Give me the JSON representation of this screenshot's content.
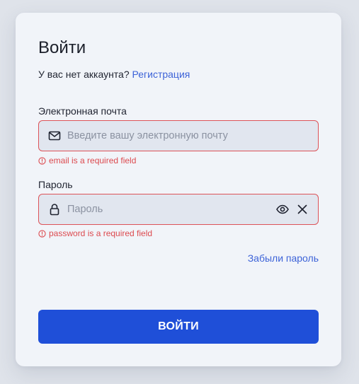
{
  "login": {
    "title": "Войти",
    "signup_prompt": "У вас нет аккаунта?",
    "signup_link": "Регистрация",
    "email": {
      "label": "Электронная почта",
      "placeholder": "Введите вашу электронную почту",
      "value": "",
      "error": "email is a required field",
      "icon": "mail-icon"
    },
    "password": {
      "label": "Пароль",
      "placeholder": "Пароль",
      "value": "",
      "error": "password is a required field",
      "icon": "lock-icon",
      "toggle_icon": "eye-icon",
      "clear_icon": "close-icon"
    },
    "forgot_password": "Забыли пароль",
    "submit_label": "ВОЙТИ"
  },
  "colors": {
    "page_background": "#dfe3ea",
    "card_background": "#f1f4f9",
    "input_background": "#e1e6ef",
    "error": "#dc4a4f",
    "link": "#3d63d8",
    "primary_button": "#1f4fd8"
  }
}
